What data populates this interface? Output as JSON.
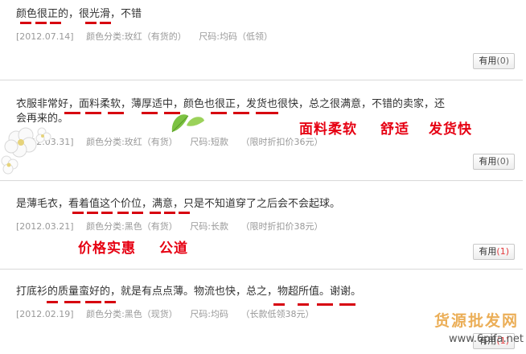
{
  "reviews": [
    {
      "content": "颜色很正的，很光滑，不错",
      "date": "[2012.07.14]",
      "color": "颜色分类:玫红（有货的）",
      "size": "尺码:均码（低领）",
      "discount": "",
      "useful_label": "有用",
      "useful_count": "(0)"
    },
    {
      "content": "衣服非常好，面料柔软，薄厚适中，颜色也很正，发货也很快，总之很满意，不错的卖家，还",
      "content2": "会再来的。",
      "date": "[2012.03.31]",
      "color": "颜色分类:玫红（有货）",
      "size": "尺码:短款",
      "discount": "（限时折扣价36元）",
      "useful_label": "有用",
      "useful_count": "(0)"
    },
    {
      "content": "是薄毛衣，看着值这个价位，满意，只是不知道穿了之后会不会起球。",
      "date": "[2012.03.21]",
      "color": "颜色分类:黑色（有货）",
      "size": "尺码:长款",
      "discount": "（限时折扣价38元）",
      "useful_label": "有用",
      "useful_count": "(1)"
    },
    {
      "content": "打底衫的质量蛮好的，就是有点点薄。物流也快，总之，物超所值。谢谢。",
      "date": "[2012.02.19]",
      "color": "颜色分类:黑色（现货）",
      "size": "尺码:均码",
      "discount": "（长款低领38元）",
      "useful_label": "有用",
      "useful_count": "(1)"
    }
  ],
  "annotations": {
    "a1": "面料柔软",
    "a2": "舒适",
    "a3": "发货快",
    "a4": "价格实惠",
    "a5": "公道"
  },
  "watermark": {
    "brand": "货源批发网",
    "url": "www.6pifa.net"
  },
  "colors": {
    "accent": "#e60012",
    "underline": "#d7000f",
    "meta": "#999999",
    "separator": "#d9d9d9"
  }
}
